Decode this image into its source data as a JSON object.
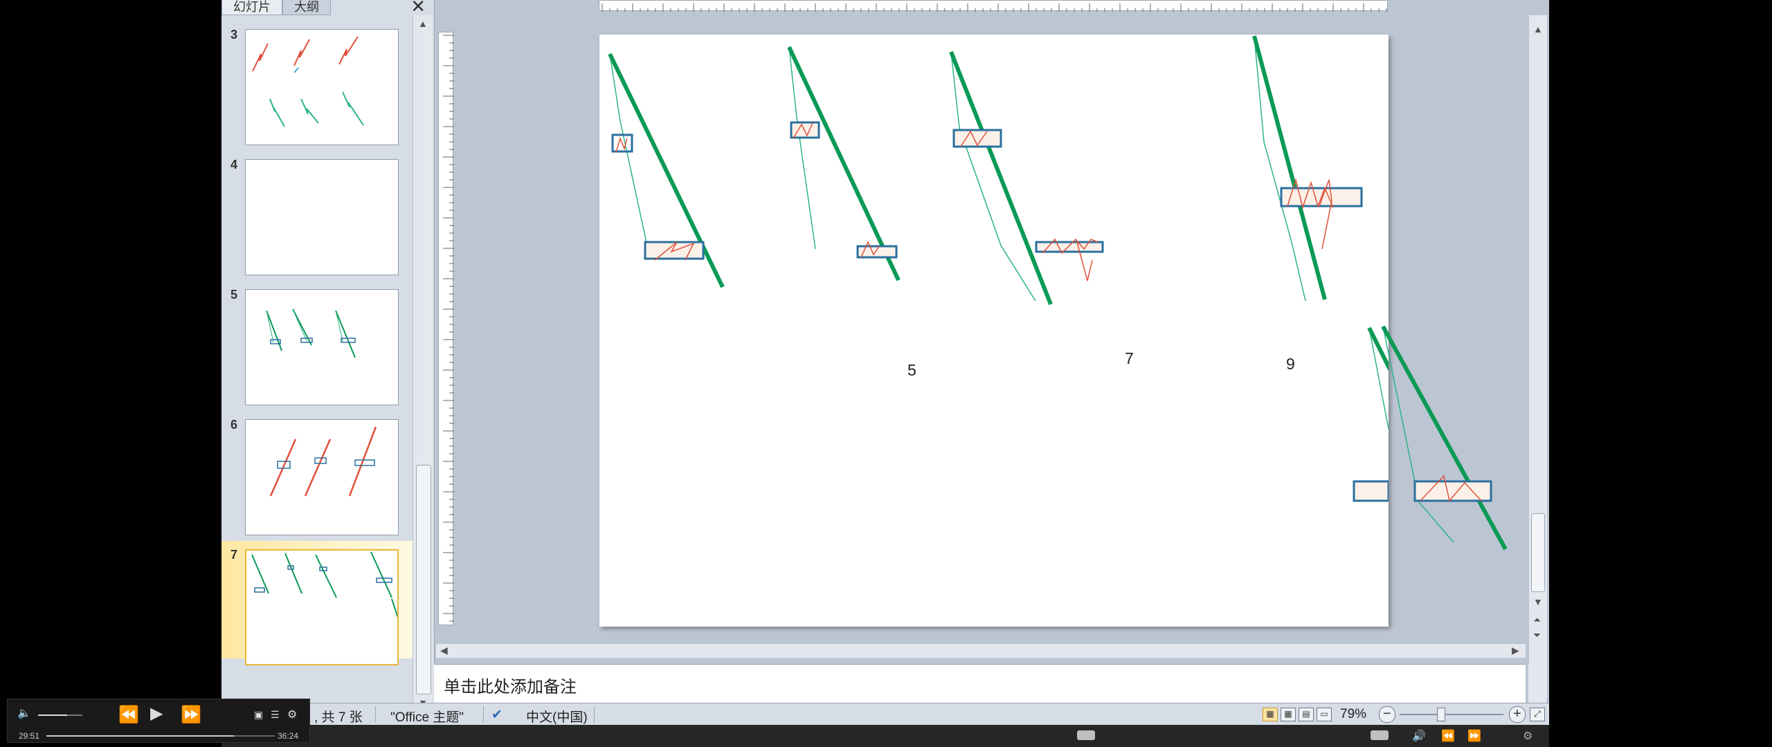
{
  "panel": {
    "tabs": [
      "幻灯片",
      "大纲"
    ],
    "slides": [
      {
        "num": "3"
      },
      {
        "num": "4"
      },
      {
        "num": "5"
      },
      {
        "num": "6"
      },
      {
        "num": "7",
        "active": true
      }
    ]
  },
  "slide": {
    "labels": [
      "5",
      "7",
      "9"
    ]
  },
  "notes": {
    "placeholder": "单击此处添加备注"
  },
  "status": {
    "slide_count": ", 共 7 张",
    "theme": "\"Office 主题\"",
    "language": "中文(中国)",
    "zoom": "79%"
  },
  "player": {
    "elapsed": "29:51",
    "total": "36:24",
    "progress": 0.82,
    "volume": 0.65
  },
  "colors": {
    "trend_green": "#0a9a55",
    "thin_green": "#2bb584",
    "box_blue": "#2a6f9e",
    "zigzag_red": "#e0503a"
  }
}
